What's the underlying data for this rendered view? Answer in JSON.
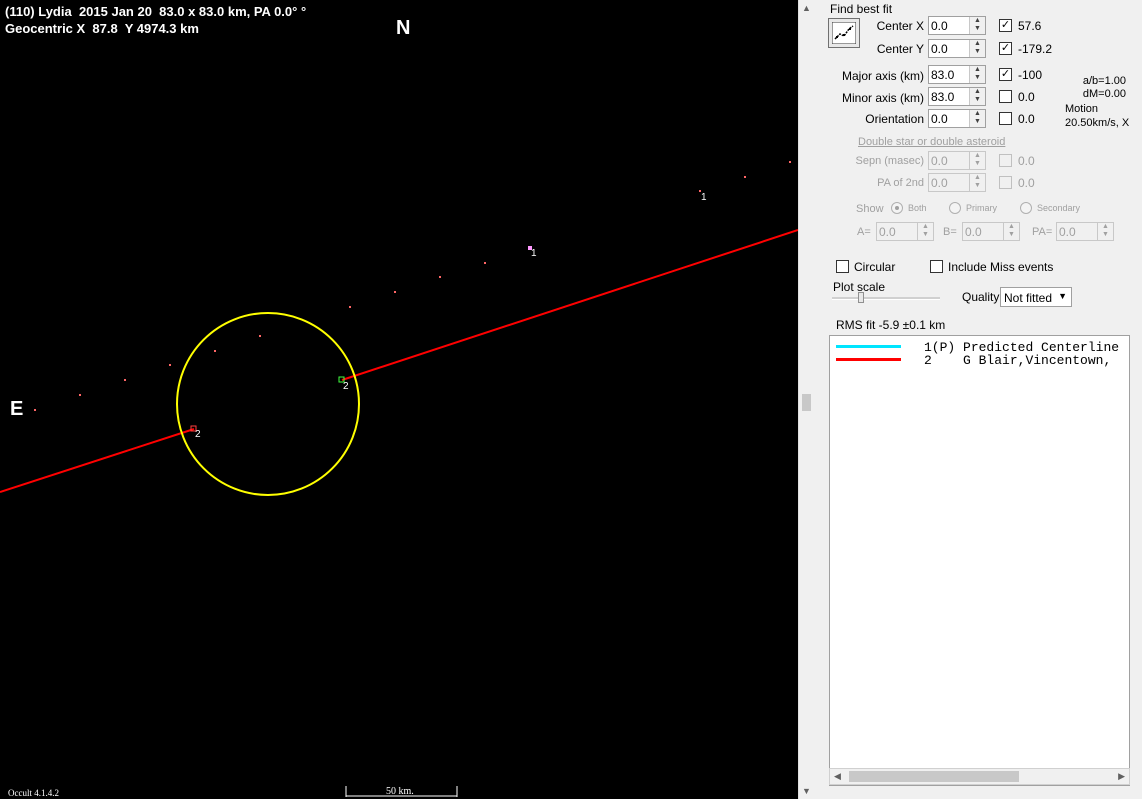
{
  "plot": {
    "header_line1": "(110) Lydia  2015 Jan 20  83.0 x 83.0 km, PA 0.0° °",
    "header_line2": "Geocentric X  87.8  Y 4974.3 km",
    "north_label": "N",
    "east_label": "E",
    "version": "Occult 4.1.4.2",
    "scale_label": "50 km.",
    "chord_markers": [
      "1",
      "1",
      "2",
      "2"
    ],
    "colors": {
      "background": "#000000",
      "ellipse": "#ffff00",
      "chord": "#ff0000",
      "predicted_points": "#ff6666"
    }
  },
  "panel": {
    "find_best_fit": "Find best fit",
    "fit_button_icon": "fit-chart-icon",
    "center_x": {
      "label": "Center X",
      "value": "0.0",
      "checked": true,
      "result": "57.6"
    },
    "center_y": {
      "label": "Center Y",
      "value": "0.0",
      "checked": true,
      "result": "-179.2"
    },
    "major_axis": {
      "label": "Major axis (km)",
      "value": "83.0",
      "checked": true,
      "result": "-100"
    },
    "minor_axis": {
      "label": "Minor axis (km)",
      "value": "83.0",
      "checked": false,
      "result": "0.0"
    },
    "orientation": {
      "label": "Orientation",
      "value": "0.0",
      "checked": false,
      "result": "0.0"
    },
    "ab_ratio": "a/b=1.00",
    "dm": "dM=0.00",
    "motion_label": "Motion",
    "motion_value": "20.50km/s, X",
    "double_star_link": "Double star  or  double asteroid",
    "sepn": {
      "label": "Sepn (masec)",
      "value": "0.0",
      "result": "0.0"
    },
    "pa_2nd": {
      "label": "PA of 2nd",
      "value": "0.0",
      "result": "0.0"
    },
    "show_label": "Show",
    "show_options": [
      "Both",
      "Primary",
      "Secondary"
    ],
    "a_label": "A=",
    "a_value": "0.0",
    "b_label": "B=",
    "b_value": "0.0",
    "pa_label": "PA=",
    "pa_value": "0.0",
    "circular_label": "Circular",
    "include_miss_label": "Include Miss events",
    "plot_scale_label": "Plot scale",
    "quality_label": "Quality",
    "quality_value": "Not fitted",
    "rms_fit": "RMS fit  -5.9 ±0.1 km",
    "legend": [
      {
        "num": "1(P)",
        "text": "Predicted Centerline",
        "color": "#00e5ff"
      },
      {
        "num": "2",
        "text": "G Blair,Vincentown,",
        "color": "#ff0000"
      }
    ]
  }
}
